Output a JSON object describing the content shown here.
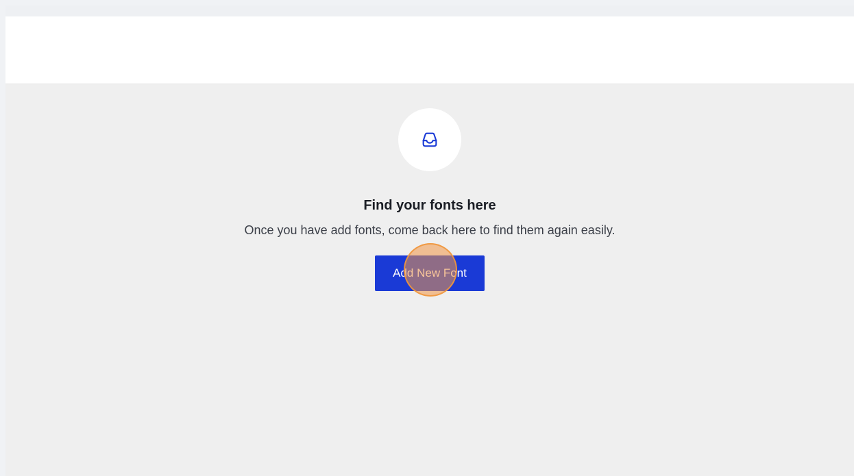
{
  "empty_state": {
    "icon": "inbox-tray-icon",
    "title": "Find your fonts here",
    "description": "Once you have add fonts, come back here to find them again easily.",
    "button_label": "Add New Font"
  },
  "colors": {
    "accent": "#1a3ad6",
    "page_background": "#efefef",
    "header_background": "#ffffff",
    "click_marker": "#f0a060"
  }
}
